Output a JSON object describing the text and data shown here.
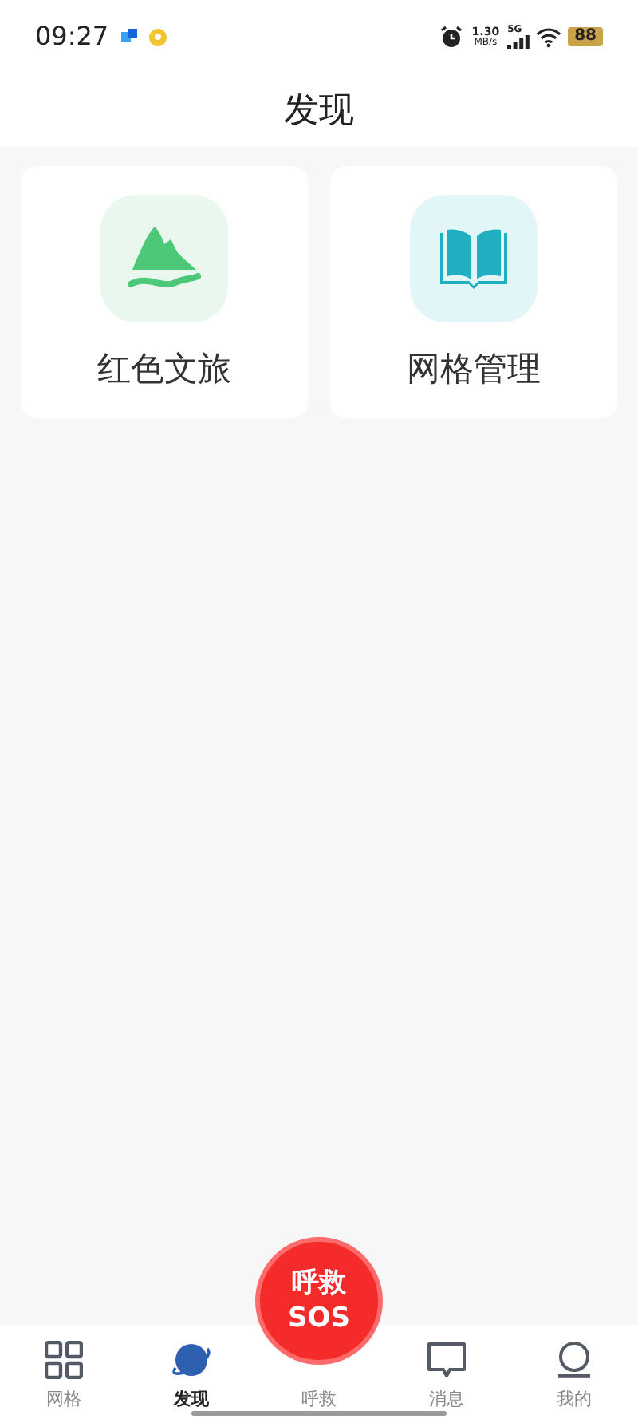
{
  "status_bar": {
    "time": "09:27",
    "net_speed": "1.30",
    "net_unit": "MB/s",
    "network": "5G",
    "battery": "88"
  },
  "header": {
    "title": "发现"
  },
  "cards": [
    {
      "label": "红色文旅",
      "kind": "mountain"
    },
    {
      "label": "网格管理",
      "kind": "book"
    }
  ],
  "sos_button": {
    "line_1": "呼救",
    "line_2": "SOS"
  },
  "tab_bar": [
    {
      "label": "网格",
      "kind": "grid",
      "selected": false
    },
    {
      "label": "发现",
      "kind": "planet",
      "selected": true
    },
    {
      "label": "呼救",
      "kind": "none",
      "selected": false
    },
    {
      "label": "消息",
      "kind": "message",
      "selected": false
    },
    {
      "label": "我的",
      "kind": "person",
      "selected": false
    }
  ]
}
